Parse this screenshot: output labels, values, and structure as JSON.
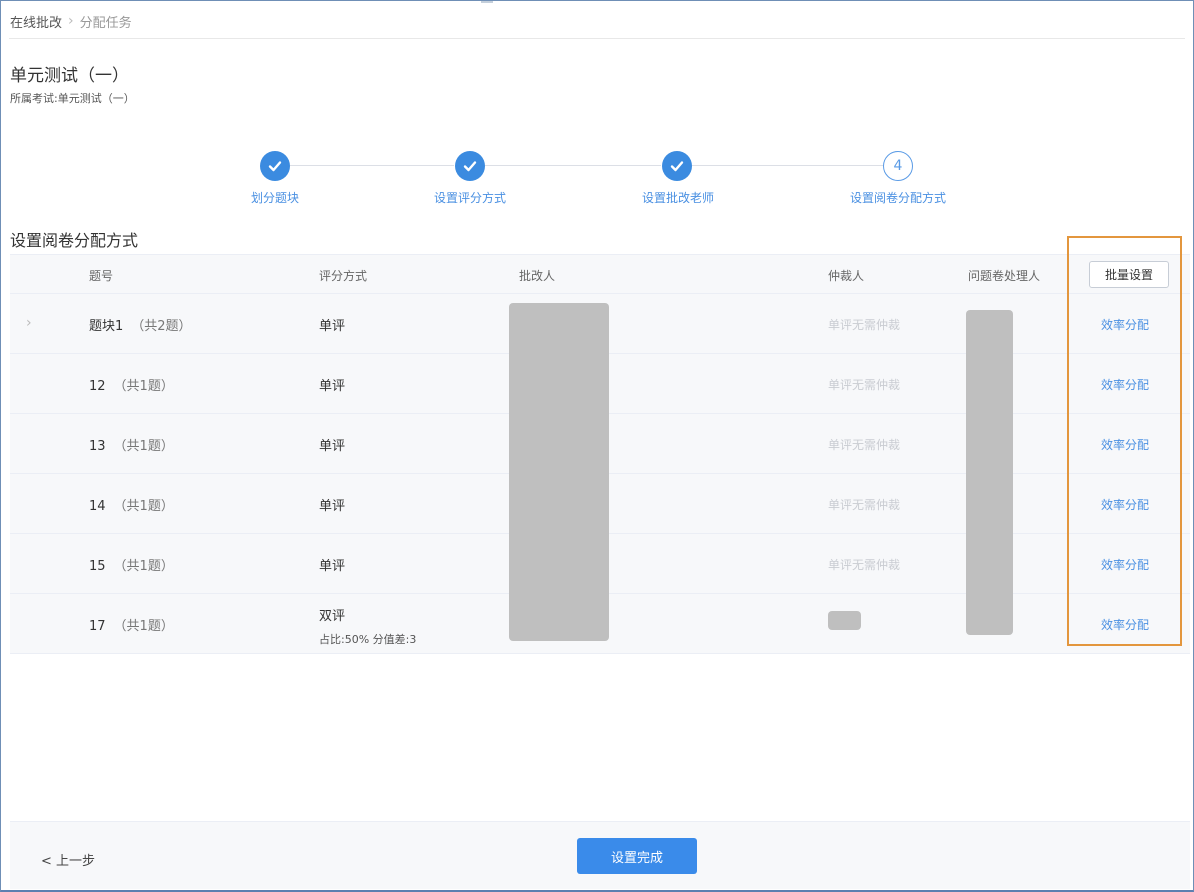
{
  "breadcrumb": {
    "root": "在线批改",
    "current": "分配任务"
  },
  "exam": {
    "title": "单元测试（一）",
    "subtitle": "所属考试:单元测试（一）"
  },
  "steps": [
    {
      "label": "划分题块",
      "status": "done"
    },
    {
      "label": "设置评分方式",
      "status": "done"
    },
    {
      "label": "设置批改老师",
      "status": "done"
    },
    {
      "label": "设置阅卷分配方式",
      "status": "current",
      "number": "4"
    }
  ],
  "section_title": "设置阅卷分配方式",
  "table": {
    "headers": {
      "question": "题号",
      "score_mode": "评分方式",
      "grader": "批改人",
      "arbiter": "仲裁人",
      "handler": "问题卷处理人"
    },
    "batch_button": "批量设置",
    "rows": [
      {
        "name": "题块1",
        "count": "（共2题）",
        "mode": "单评",
        "detail": "",
        "arbiter": "单评无需仲裁",
        "action": "效率分配"
      },
      {
        "name": "12",
        "count": "（共1题）",
        "mode": "单评",
        "detail": "",
        "arbiter": "单评无需仲裁",
        "action": "效率分配"
      },
      {
        "name": "13",
        "count": "（共1题）",
        "mode": "单评",
        "detail": "",
        "arbiter": "单评无需仲裁",
        "action": "效率分配"
      },
      {
        "name": "14",
        "count": "（共1题）",
        "mode": "单评",
        "detail": "",
        "arbiter": "单评无需仲裁",
        "action": "效率分配"
      },
      {
        "name": "15",
        "count": "（共1题）",
        "mode": "单评",
        "detail": "",
        "arbiter": "单评无需仲裁",
        "action": "效率分配"
      },
      {
        "name": "17",
        "count": "（共1题）",
        "mode": "双评",
        "detail": "占比:50% 分值差:3",
        "arbiter": "",
        "action": "效率分配"
      }
    ]
  },
  "footer": {
    "prev": "< 上一步",
    "finish": "设置完成"
  },
  "colors": {
    "accent": "#3a8bea",
    "link": "#4a90e2",
    "highlight": "#e3963d",
    "redacted": "#bfbfbf"
  }
}
